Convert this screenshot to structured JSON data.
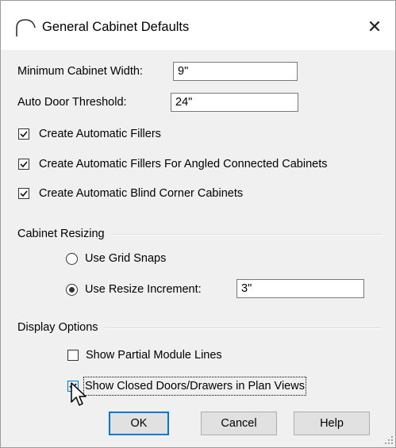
{
  "window": {
    "title": "General Cabinet Defaults",
    "close_symbol": "✕",
    "app_icon": "cabinet-arc-icon"
  },
  "fields": {
    "min_width_label": "Minimum Cabinet Width:",
    "min_width_value": "9\"",
    "auto_door_label": "Auto Door Threshold:",
    "auto_door_value": "24\""
  },
  "checkboxes": {
    "auto_fillers": {
      "label": "Create Automatic Fillers",
      "checked": true
    },
    "angled_fillers": {
      "label": "Create Automatic Fillers For Angled Connected Cabinets",
      "checked": true
    },
    "blind_corner": {
      "label": "Create Automatic Blind Corner Cabinets",
      "checked": true
    }
  },
  "resizing": {
    "group_label": "Cabinet Resizing",
    "grid_snaps_label": "Use Grid Snaps",
    "resize_increment_label": "Use Resize Increment:",
    "resize_increment_value": "3\"",
    "selected": "resize_increment"
  },
  "display": {
    "group_label": "Display Options",
    "partial_module": {
      "label": "Show Partial Module Lines",
      "checked": false
    },
    "closed_doors": {
      "label": "Show Closed Doors/Drawers in Plan Views",
      "checked": true
    }
  },
  "buttons": {
    "ok": "OK",
    "cancel": "Cancel",
    "help": "Help"
  },
  "colors": {
    "accent": "#0078d7",
    "face": "#f0f0f0",
    "titlebar": "#ffffff"
  }
}
